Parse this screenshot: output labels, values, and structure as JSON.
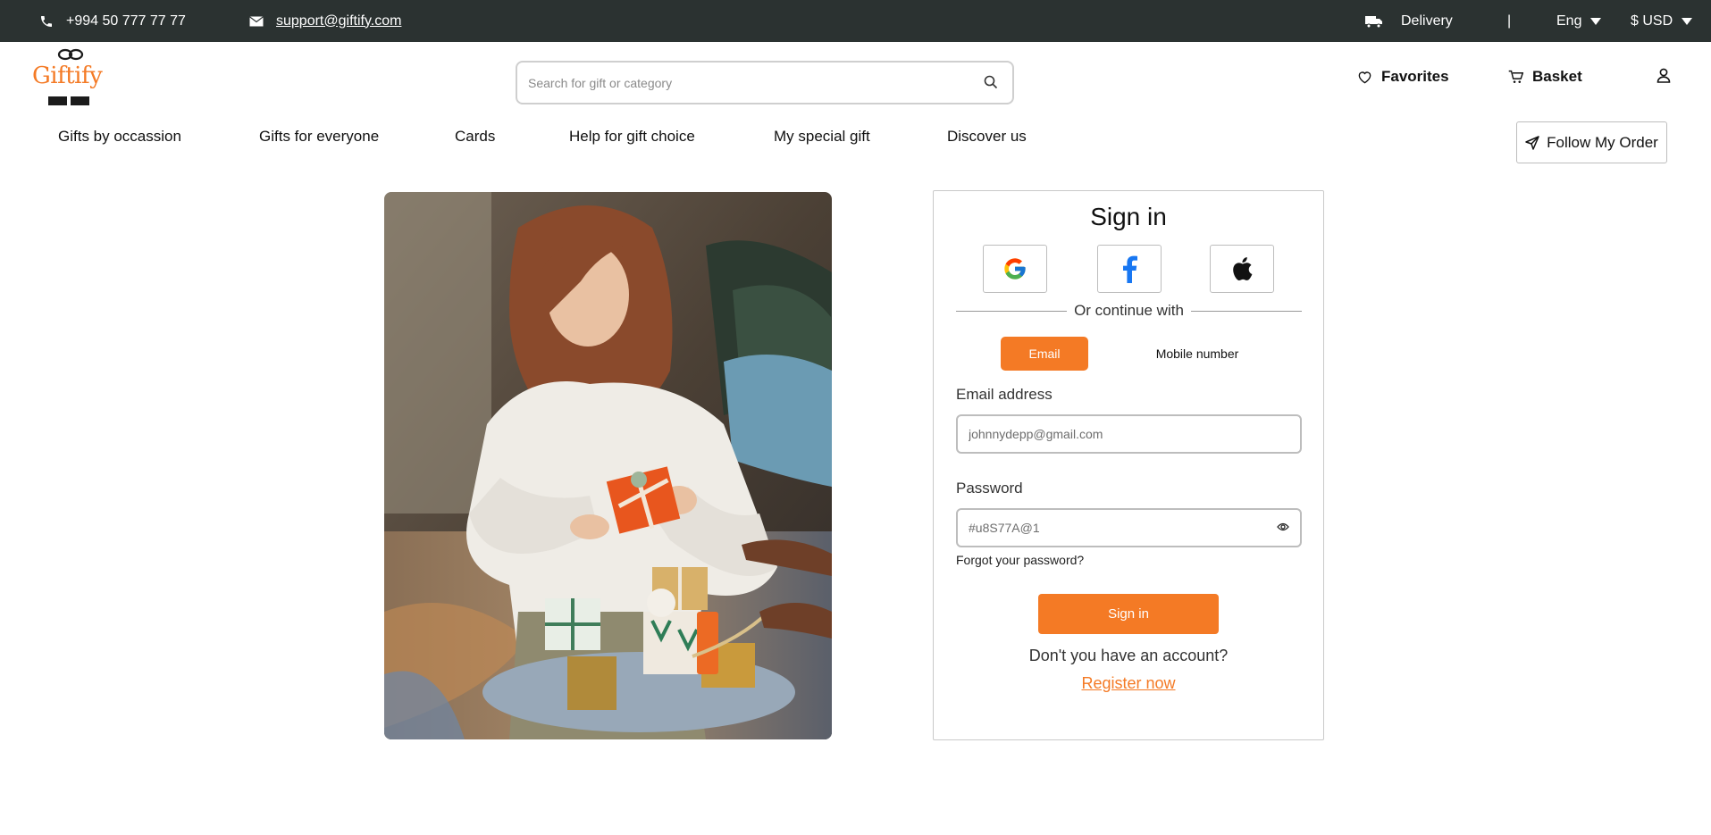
{
  "topbar": {
    "phone": "+994 50 777 77 77",
    "email": "support@giftify.com",
    "delivery": "Delivery",
    "separator": "|",
    "language": "Eng",
    "currency": "$ USD"
  },
  "header": {
    "logo_text": "Giftify",
    "search_placeholder": "Search for gift or category",
    "favorites": "Favorites",
    "basket": "Basket"
  },
  "nav": {
    "items": [
      "Gifts by occassion",
      "Gifts for everyone",
      "Cards",
      "Help for gift choice",
      "My special gift",
      "Discover us"
    ],
    "follow_order": "Follow My Order"
  },
  "signin": {
    "title": "Sign in",
    "or_continue": "Or continue with",
    "tab_email": "Email",
    "tab_mobile": "Mobile number",
    "email_label": "Email address",
    "email_placeholder": "johnnydepp@gmail.com",
    "password_label": "Password",
    "password_placeholder": "#u8S77A@1",
    "forgot": "Forgot your password?",
    "submit": "Sign in",
    "no_account": "Don't you have an account?",
    "register": "Register now"
  },
  "colors": {
    "accent": "#f47a25",
    "topbar_bg": "#2b3231"
  }
}
